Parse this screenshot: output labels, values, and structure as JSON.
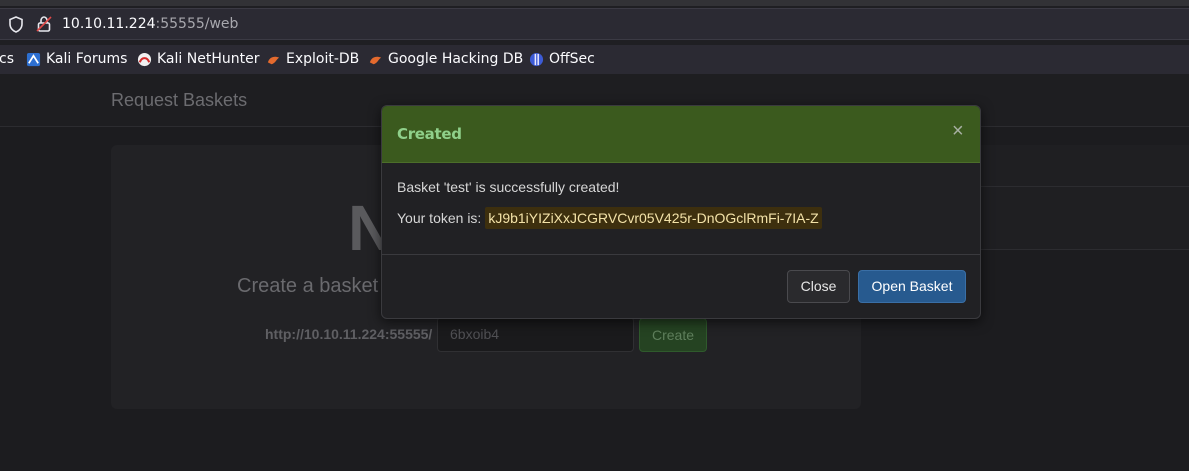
{
  "browser": {
    "url_host": "10.10.11.224",
    "url_rest": ":55555/web",
    "bookmarks": [
      {
        "label": "cs",
        "icon": "kali-docs-icon"
      },
      {
        "label": "Kali Forums",
        "icon": "kali-forums-icon"
      },
      {
        "label": "Kali NetHunter",
        "icon": "kali-nethunter-icon"
      },
      {
        "label": "Exploit-DB",
        "icon": "exploit-db-icon"
      },
      {
        "label": "Google Hacking DB",
        "icon": "ghdb-icon"
      },
      {
        "label": "OffSec",
        "icon": "offsec-icon"
      }
    ]
  },
  "page": {
    "brand": "Request Baskets",
    "big_letter": "N",
    "subhead": "Create a basket",
    "prefix": "http://10.10.11.224:55555/",
    "basket_name": "6bxoib4",
    "create_label": "Create"
  },
  "modal": {
    "title": "Created",
    "close_symbol": "×",
    "message": "Basket 'test' is successfully created!",
    "token_label": "Your token is:",
    "token": "kJ9b1iYIZiXxJCGRVCvr05V425r-DnOGclRmFi-7IA-Z",
    "close_label": "Close",
    "open_label": "Open Basket"
  },
  "colors": {
    "header_bg": "#3b5a1e",
    "title_color": "#8fd08a",
    "open_button": "#275a8f",
    "token_bg": "#3d2f0e"
  }
}
